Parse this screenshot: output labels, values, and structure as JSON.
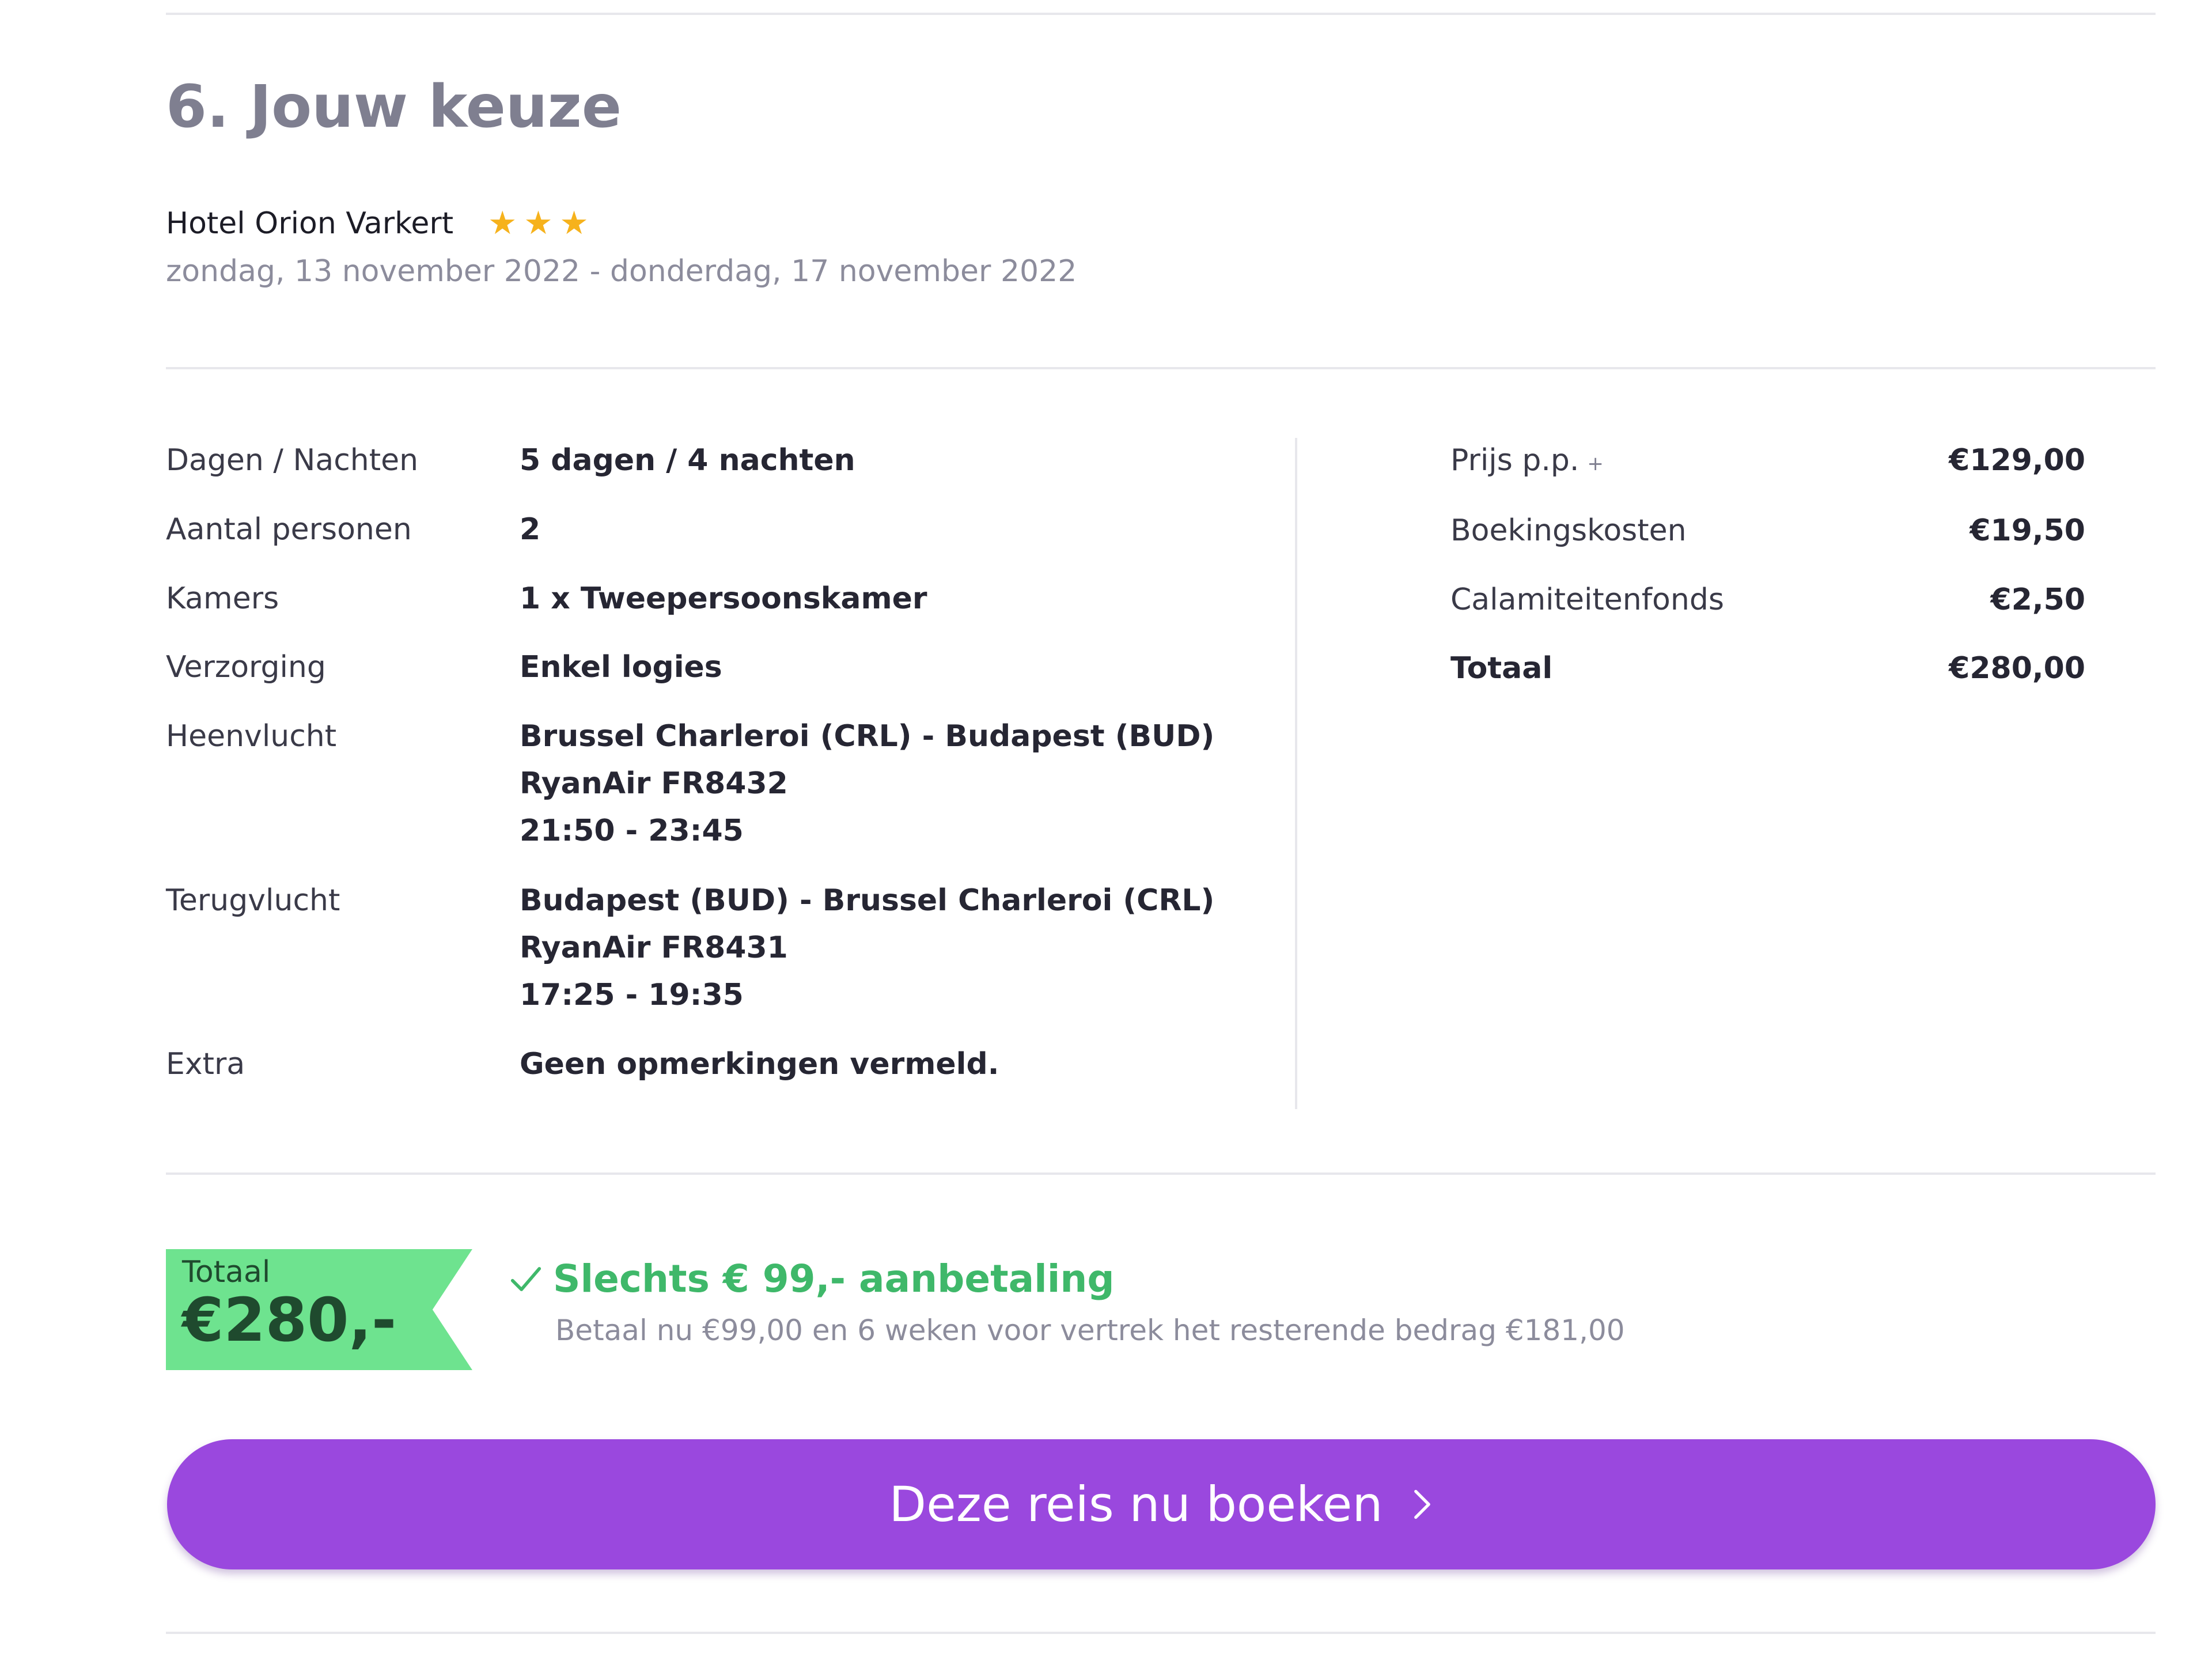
{
  "section": {
    "title": "6. Jouw keuze"
  },
  "hotel": {
    "name": "Hotel Orion Varkert",
    "stars": 3,
    "star_icon": "star-icon",
    "dates": "zondag, 13 november 2022 - donderdag, 17 november 2022"
  },
  "details": [
    {
      "label": "Dagen / Nachten",
      "lines": [
        "5 dagen / 4 nachten"
      ]
    },
    {
      "label": "Aantal personen",
      "lines": [
        "2"
      ]
    },
    {
      "label": "Kamers",
      "lines": [
        "1 x Tweepersoonskamer"
      ]
    },
    {
      "label": "Verzorging",
      "lines": [
        "Enkel logies"
      ]
    },
    {
      "label": "Heenvlucht",
      "lines": [
        "Brussel Charleroi (CRL) - Budapest (BUD)",
        "RyanAir FR8432",
        "21:50 - 23:45"
      ]
    },
    {
      "label": "Terugvlucht",
      "lines": [
        "Budapest (BUD) - Brussel Charleroi (CRL)",
        "RyanAir FR8431",
        "17:25 - 19:35"
      ]
    },
    {
      "label": "Extra",
      "lines": [
        "Geen opmerkingen vermeld."
      ]
    }
  ],
  "prices": [
    {
      "label": "Prijs p.p.",
      "info": "+",
      "value": "€129,00"
    },
    {
      "label": "Boekingskosten",
      "value": "€19,50"
    },
    {
      "label": "Calamiteitenfonds",
      "value": "€2,50"
    },
    {
      "label": "Totaal",
      "value": "€280,00"
    }
  ],
  "badge": {
    "label": "Totaal",
    "amount": "€280,-"
  },
  "deposit": {
    "title": "Slechts € 99,- aanbetaling",
    "subtitle": "Betaal nu €99,00 en 6 weken voor vertrek het resterende bedrag €181,00",
    "icon": "check-icon"
  },
  "cta": {
    "label": "Deze reis nu boeken",
    "icon": "chevron-right-icon"
  },
  "colors": {
    "title": "#7f7f90",
    "star": "#f6b21c",
    "badge_bg": "#6ee38f",
    "badge_text": "#1f4a2e",
    "deposit_green": "#3fb86a",
    "button_purple": "#9a48de",
    "divider": "#e7e7ec"
  }
}
